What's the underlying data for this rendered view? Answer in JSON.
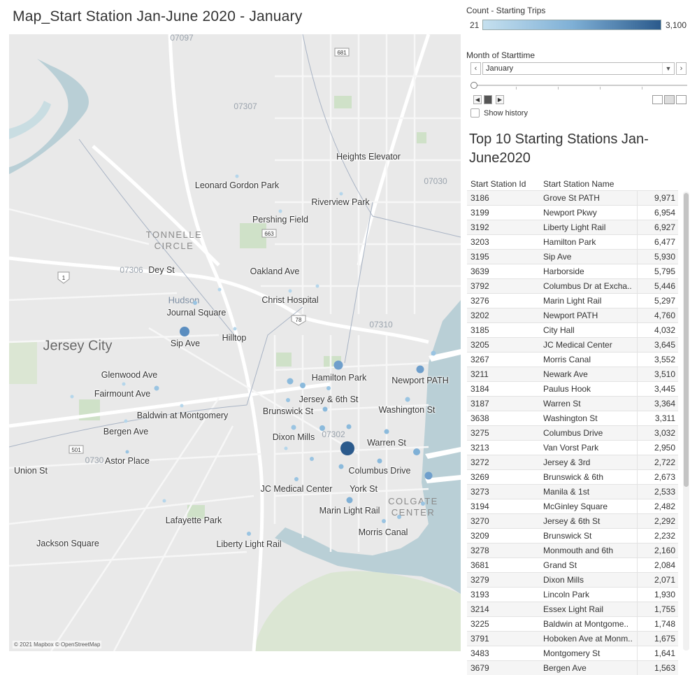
{
  "map": {
    "title": "Map_Start Station Jan-June 2020 - January",
    "copyright": "© 2021 Mapbox © OpenStreetMap",
    "city_label": "Jersey City",
    "hudson_label": "Hudson",
    "area_labels": [
      "TONNELLE\nCIRCLE",
      "COLGATE\nCENTER"
    ],
    "zip_labels": [
      "07097",
      "07307",
      "07030",
      "07306",
      "07310",
      "07302",
      "0730"
    ],
    "road_shields": [
      "681",
      "663",
      "78",
      "501",
      "1"
    ],
    "station_labels": [
      "Heights Elevator",
      "Leonard Gordon Park",
      "Riverview Park",
      "Pershing Field",
      "Dey St",
      "Oakland Ave",
      "Christ Hospital",
      "Journal Square",
      "Sip Ave",
      "Hilltop",
      "Glenwood Ave",
      "Fairmount Ave",
      "Hamilton Park",
      "Newport PATH",
      "Jersey & 6th St",
      "Brunswick St",
      "Washington St",
      "Baldwin at Montgomery",
      "Bergen Ave",
      "Dixon Mills",
      "Warren St",
      "Astor Place",
      "Union St",
      "Columbus Drive",
      "JC Medical Center",
      "York St",
      "Marin Light Rail",
      "Morris Canal",
      "Lafayette Park",
      "Jackson Square",
      "Liberty Light Rail"
    ]
  },
  "legend": {
    "title": "Count - Starting Trips",
    "min": "21",
    "max": "3,100",
    "color_low": "#c5e0ef",
    "color_high": "#2b5a8c"
  },
  "filter": {
    "title": "Month of Starttime",
    "selected": "January",
    "show_history_label": "Show history"
  },
  "table": {
    "title": "Top 10 Starting Stations Jan-June2020",
    "columns": [
      "Start Station Id",
      "Start Station Name"
    ],
    "rows": [
      [
        "3186",
        "Grove St PATH",
        "9,971"
      ],
      [
        "3199",
        "Newport Pkwy",
        "6,954"
      ],
      [
        "3192",
        "Liberty Light Rail",
        "6,927"
      ],
      [
        "3203",
        "Hamilton Park",
        "6,477"
      ],
      [
        "3195",
        "Sip Ave",
        "5,930"
      ],
      [
        "3639",
        "Harborside",
        "5,795"
      ],
      [
        "3792",
        "Columbus Dr at Excha..",
        "5,446"
      ],
      [
        "3276",
        "Marin Light Rail",
        "5,297"
      ],
      [
        "3202",
        "Newport PATH",
        "4,760"
      ],
      [
        "3185",
        "City Hall",
        "4,032"
      ],
      [
        "3205",
        "JC Medical Center",
        "3,645"
      ],
      [
        "3267",
        "Morris Canal",
        "3,552"
      ],
      [
        "3211",
        "Newark Ave",
        "3,510"
      ],
      [
        "3184",
        "Paulus Hook",
        "3,445"
      ],
      [
        "3187",
        "Warren St",
        "3,364"
      ],
      [
        "3638",
        "Washington St",
        "3,311"
      ],
      [
        "3275",
        "Columbus Drive",
        "3,032"
      ],
      [
        "3213",
        "Van Vorst Park",
        "2,950"
      ],
      [
        "3272",
        "Jersey & 3rd",
        "2,722"
      ],
      [
        "3269",
        "Brunswick & 6th",
        "2,673"
      ],
      [
        "3273",
        "Manila & 1st",
        "2,533"
      ],
      [
        "3194",
        "McGinley Square",
        "2,482"
      ],
      [
        "3270",
        "Jersey & 6th St",
        "2,292"
      ],
      [
        "3209",
        "Brunswick St",
        "2,232"
      ],
      [
        "3278",
        "Monmouth and 6th",
        "2,160"
      ],
      [
        "3681",
        "Grand St",
        "2,084"
      ],
      [
        "3279",
        "Dixon Mills",
        "2,071"
      ],
      [
        "3193",
        "Lincoln Park",
        "1,930"
      ],
      [
        "3214",
        "Essex Light Rail",
        "1,755"
      ],
      [
        "3225",
        "Baldwin at Montgome..",
        "1,748"
      ],
      [
        "3791",
        "Hoboken Ave at Monm..",
        "1,675"
      ],
      [
        "3483",
        "Montgomery St",
        "1,641"
      ],
      [
        "3679",
        "Bergen Ave",
        "1,563"
      ]
    ]
  }
}
